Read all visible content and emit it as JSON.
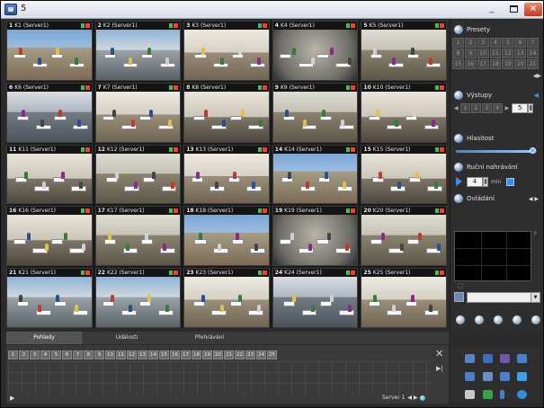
{
  "window": {
    "title": "5"
  },
  "cameras": [
    {
      "num": "1",
      "label": "K1 (Server1)"
    },
    {
      "num": "2",
      "label": "K2 (Server1)"
    },
    {
      "num": "3",
      "label": "K3 (Server1)"
    },
    {
      "num": "4",
      "label": "K4 (Server1)"
    },
    {
      "num": "5",
      "label": "K5 (Server1)"
    },
    {
      "num": "6",
      "label": "K6 (Server1)"
    },
    {
      "num": "7",
      "label": "K7 (Server1)"
    },
    {
      "num": "8",
      "label": "K8 (Server1)"
    },
    {
      "num": "9",
      "label": "K9 (Server1)"
    },
    {
      "num": "10",
      "label": "K10 (Server1)"
    },
    {
      "num": "11",
      "label": "K11 (Server1)"
    },
    {
      "num": "12",
      "label": "K12 (Server1)"
    },
    {
      "num": "13",
      "label": "K13 (Server1)"
    },
    {
      "num": "14",
      "label": "K14 (Server1)"
    },
    {
      "num": "15",
      "label": "K15 (Server1)"
    },
    {
      "num": "16",
      "label": "K16 (Server1)"
    },
    {
      "num": "17",
      "label": "K17 (Server1)"
    },
    {
      "num": "18",
      "label": "K18 (Server1)"
    },
    {
      "num": "19",
      "label": "K19 (Server1)"
    },
    {
      "num": "20",
      "label": "K20 (Server1)"
    },
    {
      "num": "21",
      "label": "K21 (Server1)"
    },
    {
      "num": "22",
      "label": "K22 (Server1)"
    },
    {
      "num": "23",
      "label": "K23 (Server1)"
    },
    {
      "num": "24",
      "label": "K24 (Server1)"
    },
    {
      "num": "25",
      "label": "K25 (Server1)"
    }
  ],
  "panel": {
    "presets": {
      "title": "Presety",
      "buttons": [
        "1",
        "2",
        "3",
        "4",
        "5",
        "6",
        "7",
        "8",
        "9",
        "10",
        "11",
        "12",
        "13",
        "14",
        "15",
        "16",
        "17",
        "18",
        "19",
        "20",
        "21"
      ]
    },
    "outputs": {
      "title": "Výstupy",
      "buttons": [
        "1",
        "2",
        "3",
        "4"
      ],
      "value": "5"
    },
    "volume": {
      "title": "Hlasitost",
      "level": 0.95
    },
    "recording": {
      "title": "Ruční nahrávání",
      "value": "4",
      "unit": "min"
    },
    "control": {
      "title": "Ovládání",
      "corner_label": "F"
    }
  },
  "tabs": [
    {
      "label": "Pohledy",
      "active": true
    },
    {
      "label": "Události",
      "active": false
    },
    {
      "label": "Přehrávání",
      "active": false
    }
  ],
  "views": [
    "1",
    "2",
    "3",
    "4",
    "5",
    "6",
    "7",
    "8",
    "9",
    "10",
    "11",
    "12",
    "13",
    "14",
    "15",
    "16",
    "17",
    "18",
    "19",
    "20",
    "21",
    "22",
    "23",
    "24",
    "25"
  ],
  "server": {
    "label": "Server 1"
  },
  "colors": {
    "accent": "#3a8cff",
    "alarm": "#ff3b2a",
    "status_ok": "#3cc24a"
  }
}
